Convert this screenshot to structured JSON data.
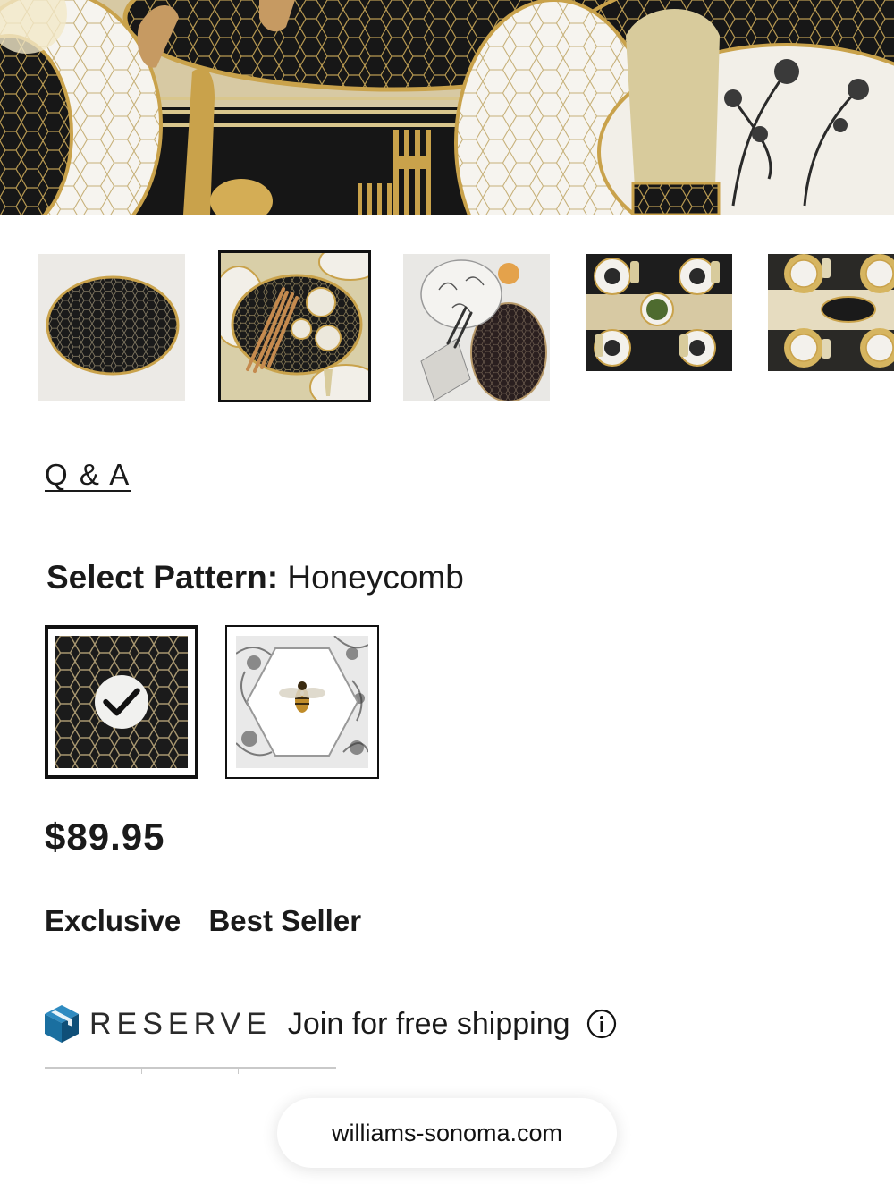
{
  "hero": {
    "icon": "product-lifestyle-photo"
  },
  "gallery": {
    "thumbnails": [
      {
        "icon": "platter-honeycomb-photo",
        "selected": false
      },
      {
        "icon": "platter-with-breadsticks-photo",
        "selected": true
      },
      {
        "icon": "platter-with-bowls-photo",
        "selected": false
      },
      {
        "icon": "table-setting-overhead-photo",
        "selected": false
      },
      {
        "icon": "table-setting-gold-photo",
        "selected": false
      }
    ]
  },
  "qa_link": "Q & A",
  "pattern": {
    "label": "Select Pattern:",
    "value": "Honeycomb",
    "options": [
      {
        "name": "Honeycomb",
        "selected": true,
        "icon": "honeycomb-swatch"
      },
      {
        "name": "Bee",
        "selected": false,
        "icon": "bee-swatch"
      }
    ]
  },
  "price": "$89.95",
  "badges": [
    "Exclusive",
    "Best Seller"
  ],
  "reserve": {
    "word": "RESERVE",
    "text": "Join for free shipping",
    "icon": "reserve-box-icon"
  },
  "browser": {
    "url": "williams-sonoma.com"
  },
  "colors": {
    "accent": "#1a6fa0",
    "dark": "#111111",
    "gold": "#c9a24b"
  }
}
